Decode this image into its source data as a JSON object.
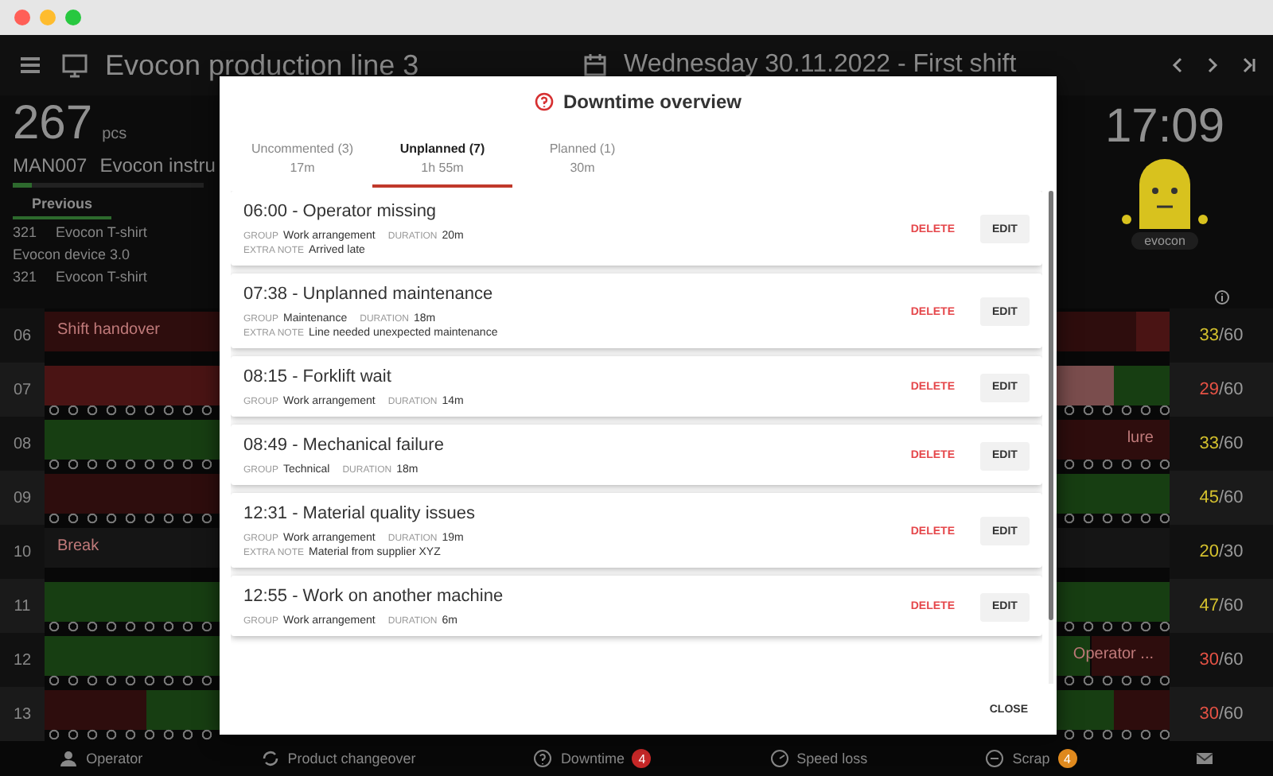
{
  "window": {
    "controls": [
      {
        "color": "#ff5f57"
      },
      {
        "color": "#febc2e"
      },
      {
        "color": "#28c840"
      }
    ]
  },
  "header": {
    "station": "Evocon production line 3",
    "shift": "Wednesday 30.11.2022 - First shift"
  },
  "info": {
    "quantity": "267",
    "unit": "pcs",
    "product_code": "MAN007",
    "product_name": "Evocon instru",
    "level": 0.1,
    "tab": "Previous",
    "history": [
      {
        "code": "321",
        "name": "Evocon T-shirt"
      },
      {
        "name": "Evocon device 3.0"
      },
      {
        "code": "321",
        "name": "Evocon T-shirt"
      }
    ]
  },
  "clock": "17:09",
  "mascot_label": "evocon",
  "hours": [
    {
      "hour": "06",
      "label": "Shift handover",
      "count": "33",
      "target": "/60",
      "color": "#d4c12e"
    },
    {
      "hour": "07",
      "count": "29",
      "target": "/60",
      "color": "#e55245"
    },
    {
      "hour": "08",
      "right_label": "lure",
      "count": "33",
      "target": "/60",
      "color": "#d4c12e"
    },
    {
      "hour": "09",
      "count": "45",
      "target": "/60",
      "color": "#d4c12e"
    },
    {
      "hour": "10",
      "label": "Break",
      "count": "20",
      "target": "/30",
      "color": "#d4c12e"
    },
    {
      "hour": "11",
      "count": "47",
      "target": "/60",
      "color": "#d4c12e"
    },
    {
      "hour": "12",
      "right_label": "Operator ...",
      "count": "30",
      "target": "/60",
      "color": "#e55245"
    },
    {
      "hour": "13",
      "count": "30",
      "target": "/60",
      "color": "#e55245"
    }
  ],
  "bottom_bar": [
    {
      "kind": "operator",
      "label": "Operator"
    },
    {
      "kind": "changeover",
      "label": "Product changeover"
    },
    {
      "kind": "downtime",
      "label": "Downtime",
      "badge": "4",
      "color": "#c62828"
    },
    {
      "kind": "speed",
      "label": "Speed loss"
    },
    {
      "kind": "scrap",
      "label": "Scrap",
      "badge": "4",
      "color": "#e08a1e"
    },
    {
      "kind": "mail"
    }
  ],
  "modal": {
    "title": "Downtime overview",
    "tabs": [
      {
        "label": "Uncommented (3)",
        "duration": "17m",
        "selected": false
      },
      {
        "label": "Unplanned (7)",
        "duration": "1h 55m",
        "selected": true
      },
      {
        "label": "Planned (1)",
        "duration": "30m",
        "selected": false
      }
    ],
    "entries": [
      {
        "title": "06:00 - Operator missing",
        "fields": [
          {
            "label": "GROUP",
            "value": "Work arrangement"
          },
          {
            "label": "DURATION",
            "value": "20m"
          }
        ],
        "note": {
          "label": "EXTRA NOTE",
          "value": "Arrived late"
        },
        "delete": "DELETE",
        "edit": "EDIT"
      },
      {
        "title": "07:38 - Unplanned maintenance",
        "fields": [
          {
            "label": "GROUP",
            "value": "Maintenance"
          },
          {
            "label": "DURATION",
            "value": "18m"
          }
        ],
        "note": {
          "label": "EXTRA NOTE",
          "value": "Line needed unexpected maintenance"
        },
        "delete": "DELETE",
        "edit": "EDIT"
      },
      {
        "title": "08:15 - Forklift wait",
        "fields": [
          {
            "label": "GROUP",
            "value": "Work arrangement"
          },
          {
            "label": "DURATION",
            "value": "14m"
          }
        ],
        "delete": "DELETE",
        "edit": "EDIT"
      },
      {
        "title": "08:49 - Mechanical failure",
        "fields": [
          {
            "label": "GROUP",
            "value": "Technical"
          },
          {
            "label": "DURATION",
            "value": "18m"
          }
        ],
        "delete": "DELETE",
        "edit": "EDIT"
      },
      {
        "title": "12:31 - Material quality issues",
        "fields": [
          {
            "label": "GROUP",
            "value": "Work arrangement"
          },
          {
            "label": "DURATION",
            "value": "19m"
          }
        ],
        "note": {
          "label": "EXTRA NOTE",
          "value": "Material from supplier XYZ"
        },
        "delete": "DELETE",
        "edit": "EDIT"
      },
      {
        "title": "12:55 - Work on another machine",
        "fields": [
          {
            "label": "GROUP",
            "value": "Work arrangement"
          },
          {
            "label": "DURATION",
            "value": "6m"
          }
        ],
        "delete": "DELETE",
        "edit": "EDIT"
      }
    ],
    "close": "CLOSE"
  }
}
